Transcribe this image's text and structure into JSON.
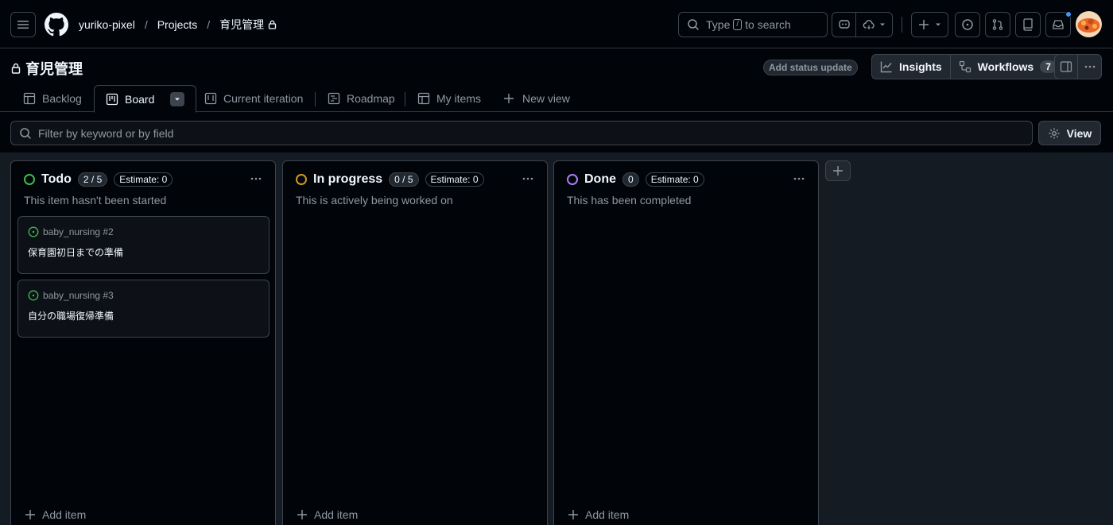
{
  "header": {
    "owner": "yuriko-pixel",
    "projects": "Projects",
    "project": "育児管理",
    "search_prefix": "Type",
    "search_key": "/",
    "search_suffix": "to search"
  },
  "project_bar": {
    "title": "育児管理",
    "status_update": "Add status update",
    "insights": "Insights",
    "workflows": "Workflows",
    "workflows_count": "7"
  },
  "tabs": [
    {
      "label": "Backlog"
    },
    {
      "label": "Board"
    },
    {
      "label": "Current iteration"
    },
    {
      "label": "Roadmap"
    },
    {
      "label": "My items"
    },
    {
      "label": "New view"
    }
  ],
  "filter": {
    "placeholder": "Filter by keyword or by field",
    "view_label": "View"
  },
  "columns": [
    {
      "name": "Todo",
      "count": "2 / 5",
      "estimate": "Estimate: 0",
      "description": "This item hasn't been started",
      "color": "#3fb950",
      "cards": [
        {
          "repo": "baby_nursing #2",
          "title": "保育園初日までの準備"
        },
        {
          "repo": "baby_nursing #3",
          "title": "自分の職場復帰準備"
        }
      ],
      "add_item": "Add item"
    },
    {
      "name": "In progress",
      "count": "0 / 5",
      "estimate": "Estimate: 0",
      "description": "This is actively being worked on",
      "color": "#d29922",
      "cards": [],
      "add_item": "Add item"
    },
    {
      "name": "Done",
      "count": "0",
      "estimate": "Estimate: 0",
      "description": "This has been completed",
      "color": "#ab7df8",
      "cards": [],
      "add_item": "Add item"
    }
  ],
  "colors": {
    "background": "#010409",
    "border": "#3d444d",
    "issue_open": "#3fb950",
    "notification": "#4493f8"
  }
}
